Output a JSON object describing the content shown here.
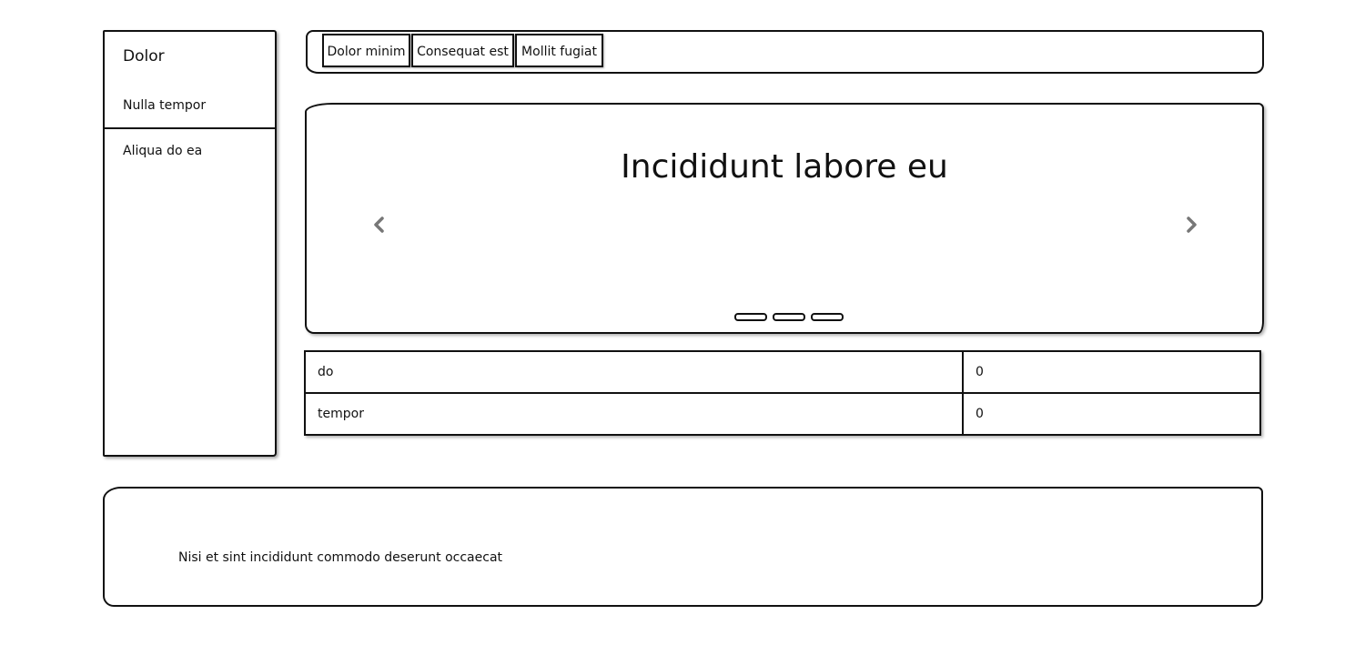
{
  "sidebar": {
    "title": "Dolor",
    "items": [
      {
        "label": "Nulla tempor"
      },
      {
        "label": "Aliqua do ea"
      }
    ]
  },
  "tabs": [
    {
      "label": "Dolor minim"
    },
    {
      "label": "Consequat est"
    },
    {
      "label": "Mollit fugiat"
    }
  ],
  "carousel": {
    "title": "Incididunt labore eu",
    "prev_icon": "chevron-left-icon",
    "next_icon": "chevron-right-icon",
    "slide_count": 3
  },
  "table": {
    "rows": [
      {
        "name": "do",
        "value": "0"
      },
      {
        "name": "tempor",
        "value": "0"
      }
    ]
  },
  "footer": {
    "text": "Nisi et sint incididunt commodo deserunt occaecat"
  },
  "colors": {
    "stroke": "#111111",
    "arrow": "#777777"
  }
}
